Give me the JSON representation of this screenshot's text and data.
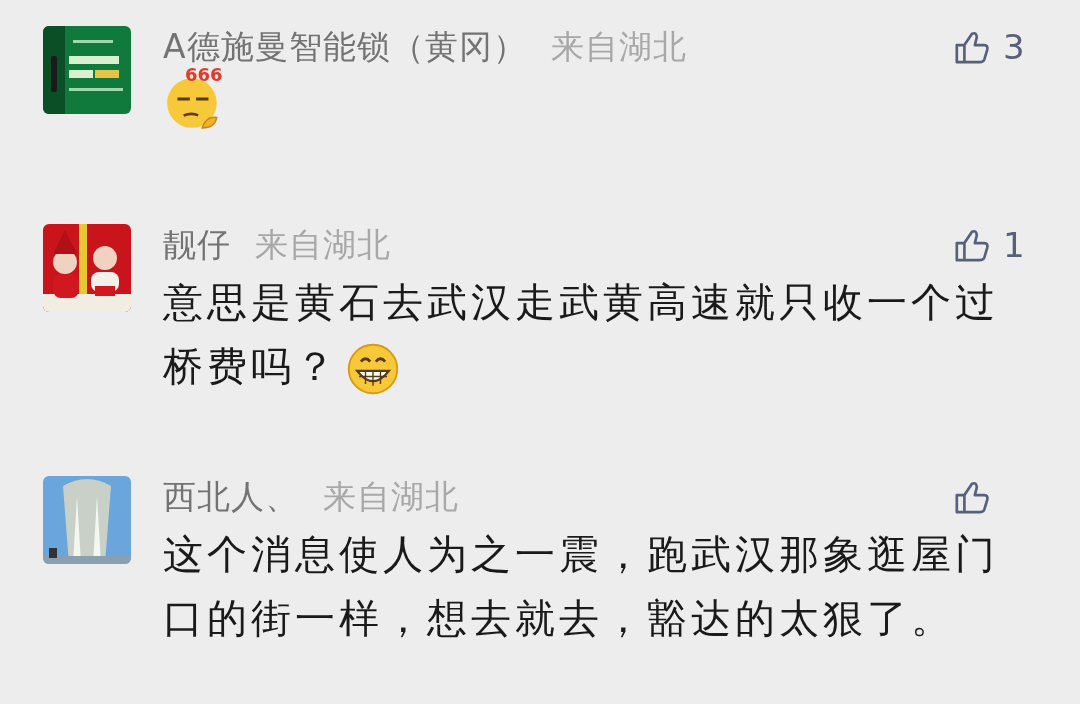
{
  "comments": [
    {
      "name": "A德施曼智能锁（黄冈）",
      "location": "来自湖北",
      "likes": "3",
      "emoji": {
        "kind": "smirk",
        "caption": "666"
      }
    },
    {
      "name": "靓仔",
      "location": "来自湖北",
      "likes": "1",
      "text": "意思是黄石去武汉走武黄高速就只收一个过桥费吗？",
      "emoji": {
        "kind": "grin"
      }
    },
    {
      "name": "西北人、",
      "location": "来自湖北",
      "text": "这个消息使人为之一震，跑武汉那象逛屋门口的街一样，想去就去，豁达的太狠了。"
    }
  ]
}
